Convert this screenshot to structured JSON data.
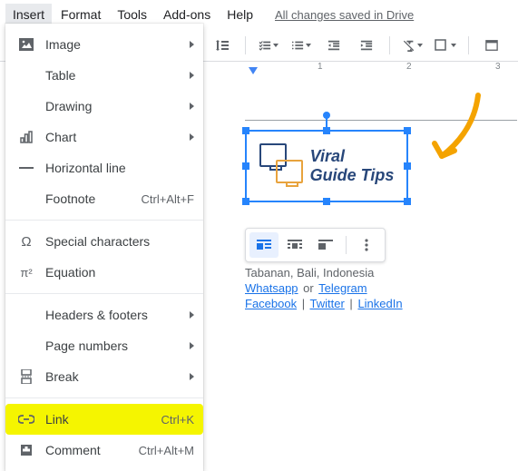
{
  "menubar": {
    "items": [
      "Insert",
      "Format",
      "Tools",
      "Add-ons",
      "Help"
    ],
    "active_index": 0,
    "save_status": "All changes saved in Drive"
  },
  "ruler": {
    "labels": [
      "1",
      "2",
      "3"
    ]
  },
  "dropdown": {
    "groups": [
      [
        {
          "icon": "image",
          "label": "Image",
          "submenu": true
        },
        {
          "icon": "",
          "label": "Table",
          "submenu": true
        },
        {
          "icon": "",
          "label": "Drawing",
          "submenu": true
        },
        {
          "icon": "chart",
          "label": "Chart",
          "submenu": true
        },
        {
          "icon": "hr",
          "label": "Horizontal line"
        },
        {
          "icon": "",
          "label": "Footnote",
          "shortcut": "Ctrl+Alt+F"
        }
      ],
      [
        {
          "icon": "omega",
          "label": "Special characters"
        },
        {
          "icon": "pi",
          "label": "Equation"
        }
      ],
      [
        {
          "icon": "",
          "label": "Headers & footers",
          "submenu": true
        },
        {
          "icon": "",
          "label": "Page numbers",
          "submenu": true
        },
        {
          "icon": "break",
          "label": "Break",
          "submenu": true
        }
      ],
      [
        {
          "icon": "link",
          "label": "Link",
          "shortcut": "Ctrl+K",
          "highlight": true
        },
        {
          "icon": "comment",
          "label": "Comment",
          "shortcut": "Ctrl+Alt+M"
        }
      ]
    ]
  },
  "canvas": {
    "logo": {
      "line1": "Viral",
      "line2": "Guide Tips"
    },
    "address": "Tabanan, Bali, Indonesia",
    "links_row1": {
      "a": "Whatsapp",
      "sep": "or",
      "b": "Telegram"
    },
    "links_row2": {
      "a": "Facebook",
      "b": "Twitter",
      "c": "LinkedIn"
    }
  }
}
